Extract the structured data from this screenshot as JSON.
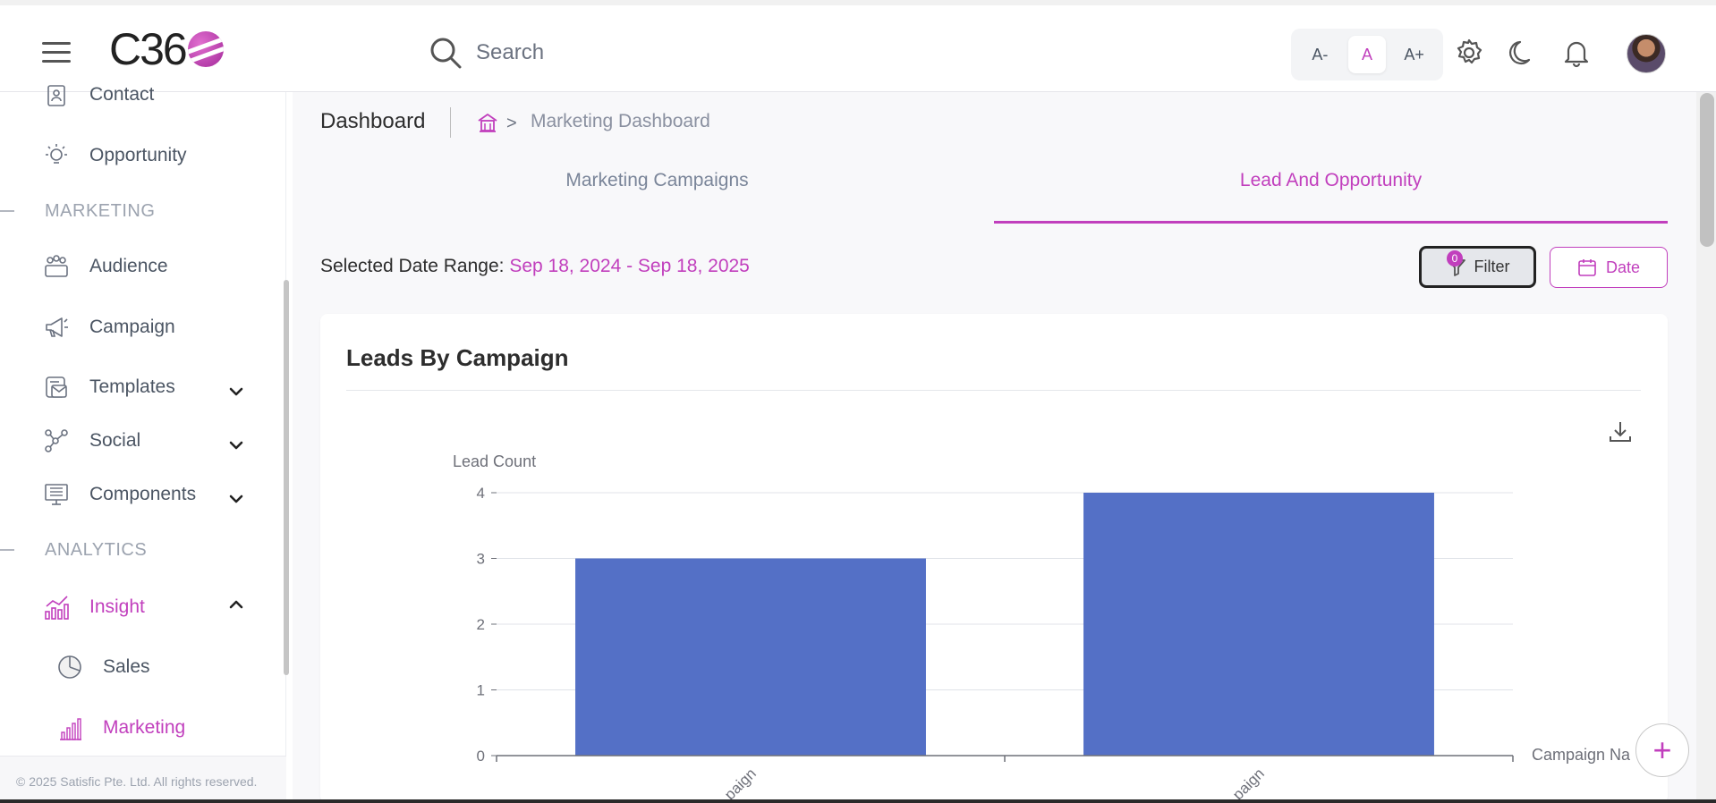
{
  "header": {
    "logo_text": "C36",
    "search_placeholder": "Search",
    "font_small": "A-",
    "font_normal": "A",
    "font_large": "A+"
  },
  "sidebar": {
    "items": [
      {
        "label": "Contact",
        "icon": "contact-icon"
      },
      {
        "label": "Opportunity",
        "icon": "lightbulb-icon"
      },
      {
        "label": "Audience",
        "icon": "audience-icon"
      },
      {
        "label": "Campaign",
        "icon": "megaphone-icon"
      },
      {
        "label": "Templates",
        "icon": "templates-icon"
      },
      {
        "label": "Social",
        "icon": "social-icon"
      },
      {
        "label": "Components",
        "icon": "components-icon"
      },
      {
        "label": "Insight",
        "icon": "insight-icon"
      },
      {
        "label": "Sales",
        "icon": "pie-icon"
      },
      {
        "label": "Marketing",
        "icon": "bar-chart-icon"
      }
    ],
    "section_marketing": "MARKETING",
    "section_analytics": "ANALYTICS",
    "footer": "© 2025 Satisfic Pte. Ltd. All rights reserved."
  },
  "breadcrumb": {
    "title": "Dashboard",
    "separator": ">",
    "page": "Marketing Dashboard"
  },
  "tabs": [
    "Marketing Campaigns",
    "Lead And Opportunity"
  ],
  "date_range": {
    "label": "Selected Date Range: ",
    "value": "Sep 18, 2024 - Sep 18, 2025"
  },
  "buttons": {
    "filter": "Filter",
    "filter_count": "0",
    "date": "Date",
    "fab": "+"
  },
  "colors": {
    "accent": "#c13fbd",
    "bar": "#5470c6"
  },
  "card": {
    "title": "Leads By Campaign"
  },
  "chart_data": {
    "type": "bar",
    "title": "Leads By Campaign",
    "ylabel": "Lead Count",
    "xlabel": "Campaign Na",
    "categories": [
      "paign",
      "paign"
    ],
    "values": [
      3,
      4
    ],
    "ylim": [
      0,
      4
    ],
    "yticks": [
      0,
      1,
      2,
      3,
      4
    ],
    "grid": true
  }
}
